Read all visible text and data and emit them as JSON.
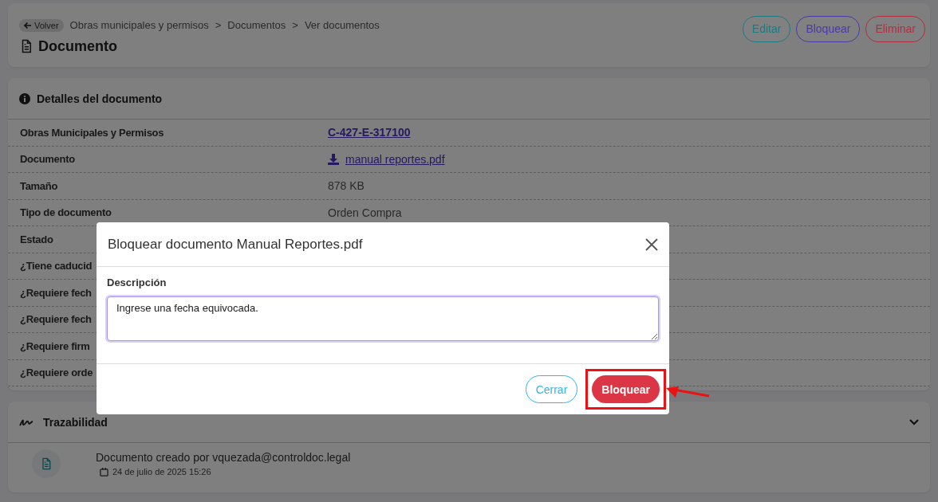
{
  "header": {
    "back_label": "Volver",
    "breadcrumbs": [
      "Obras municipales y permisos",
      "Documentos",
      "Ver documentos"
    ],
    "separator": ">",
    "title": "Documento",
    "actions": [
      {
        "label": "Editar",
        "color": "#1f7a80"
      },
      {
        "label": "Bloquear",
        "color": "#4a3aa8"
      },
      {
        "label": "Eliminar",
        "color": "#b03040"
      }
    ]
  },
  "details": {
    "title": "Detalles del documento",
    "rows": [
      {
        "label": "Obras Municipales y Permisos",
        "value": "C-427-E-317100",
        "kind": "link"
      },
      {
        "label": "Documento",
        "value": "manual reportes.pdf",
        "kind": "download"
      },
      {
        "label": "Tamaño",
        "value": "878 KB",
        "kind": "text"
      },
      {
        "label": "Tipo de documento",
        "value": "Orden Compra",
        "kind": "text"
      },
      {
        "label": "Estado"
      },
      {
        "label": "¿Tiene caducid"
      },
      {
        "label": "¿Requiere fech"
      },
      {
        "label": "¿Requiere fech"
      },
      {
        "label": "¿Requiere firm"
      },
      {
        "label": "¿Requiere orde"
      }
    ]
  },
  "traceability": {
    "title": "Trazabilidad",
    "expanded": true,
    "events": [
      {
        "text": "Documento creado por vquezada@controldoc.legal",
        "date": "24 de julio de 2025 15:26"
      }
    ]
  },
  "modal": {
    "title": "Bloquear documento Manual Reportes.pdf",
    "field_label": "Descripción",
    "value": "Ingrese una fecha equivocada.",
    "buttons": [
      {
        "label": "Cerrar",
        "kind": "secondary",
        "highlighted": false
      },
      {
        "label": "Bloquear",
        "kind": "danger",
        "highlighted": true
      }
    ]
  }
}
